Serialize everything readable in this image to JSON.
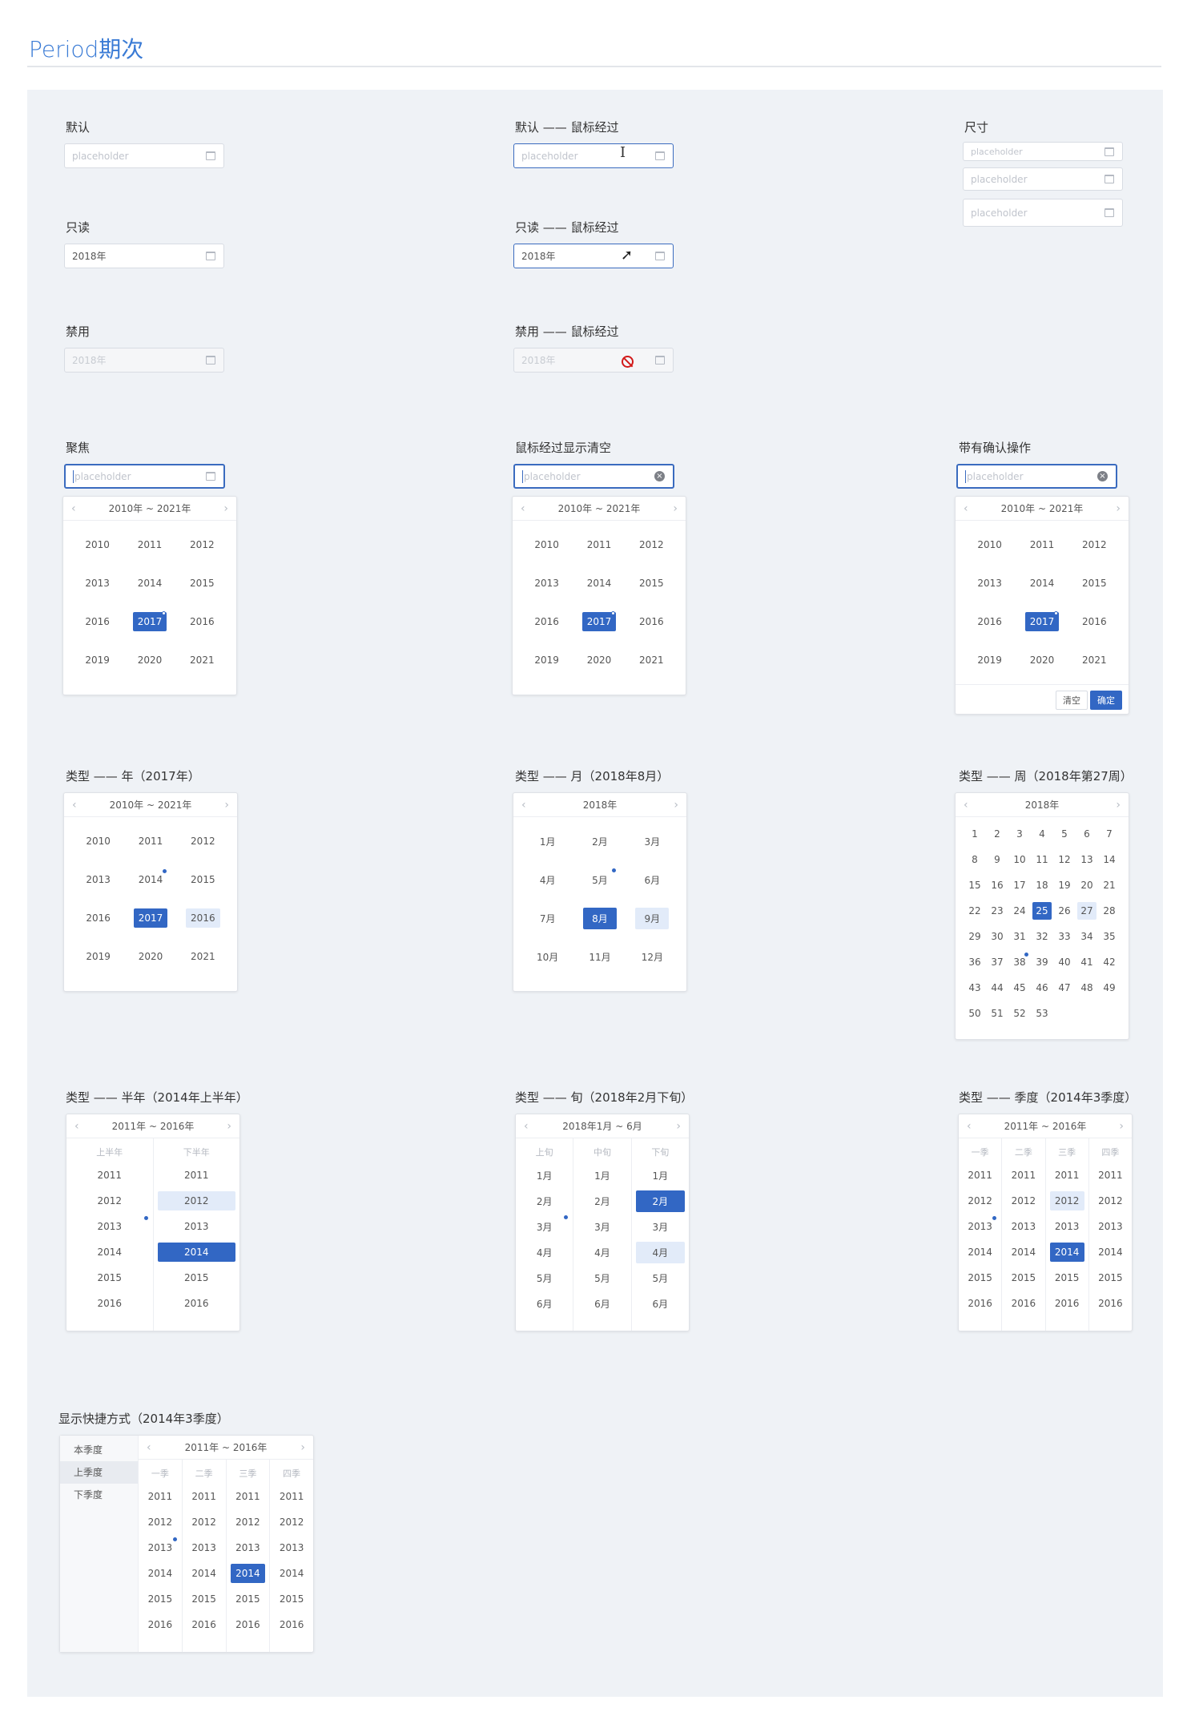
{
  "page_title": "Period期次",
  "labels": {
    "default": "默认",
    "default_hover": "默认 —— 鼠标经过",
    "size": "尺寸",
    "readonly": "只读",
    "readonly_hover": "只读 —— 鼠标经过",
    "disabled": "禁用",
    "disabled_hover": "禁用 —— 鼠标经过",
    "focus": "聚焦",
    "hover_clear": "鼠标经过显示清空",
    "confirm": "带有确认操作",
    "type_year": "类型 —— 年（2017年）",
    "type_month": "类型 —— 月（2018年8月）",
    "type_week": "类型 —— 周（2018年第27周）",
    "type_half": "类型 —— 半年（2014年上半年）",
    "type_ten": "类型 —— 旬（2018年2月下旬）",
    "type_quarter": "类型 —— 季度（2014年3季度）",
    "shortcut": "显示快捷方式（2014年3季度）"
  },
  "inputs": {
    "placeholder": "placeholder",
    "value": "2018年"
  },
  "year_header": "2010年 ~ 2021年",
  "years": [
    "2010",
    "2011",
    "2012",
    "2013",
    "2014",
    "2015",
    "2016",
    "2017",
    "2016",
    "2019",
    "2020",
    "2021"
  ],
  "type_years": [
    "2010",
    "2011",
    "2012",
    "2013",
    "2014",
    "2015",
    "2016",
    "2017",
    "2016",
    "2019",
    "2020",
    "2021"
  ],
  "month_header": "2018年",
  "months": [
    "1月",
    "2月",
    "3月",
    "4月",
    "5月",
    "6月",
    "7月",
    "8月",
    "9月",
    "10月",
    "11月",
    "12月"
  ],
  "week_header": "2018年",
  "weeks": [
    "1",
    "2",
    "3",
    "4",
    "5",
    "6",
    "7",
    "8",
    "9",
    "10",
    "11",
    "12",
    "13",
    "14",
    "15",
    "16",
    "17",
    "18",
    "19",
    "20",
    "21",
    "22",
    "23",
    "24",
    "25",
    "26",
    "27",
    "28",
    "29",
    "30",
    "31",
    "32",
    "33",
    "34",
    "35",
    "36",
    "37",
    "38",
    "39",
    "40",
    "41",
    "42",
    "43",
    "44",
    "45",
    "46",
    "47",
    "48",
    "49",
    "50",
    "51",
    "52",
    "53"
  ],
  "range_header": "2011年 ~ 2016年",
  "range_years": [
    "2011",
    "2012",
    "2013",
    "2014",
    "2015",
    "2016"
  ],
  "half": {
    "cols": [
      "上半年",
      "下半年"
    ]
  },
  "ten": {
    "header": "2018年1月 ~ 6月",
    "cols": [
      "上旬",
      "中旬",
      "下旬"
    ],
    "months": [
      "1月",
      "2月",
      "3月",
      "4月",
      "5月",
      "6月"
    ]
  },
  "quarter": {
    "cols": [
      "一季",
      "二季",
      "三季",
      "四季"
    ]
  },
  "buttons": {
    "clear": "清空",
    "ok": "确定"
  },
  "shortcuts": [
    "本季度",
    "上季度",
    "下季度"
  ],
  "icons": {
    "prev": "‹",
    "next": "›",
    "clear": "×",
    "calendar": "calendar-icon"
  },
  "colors": {
    "accent": "#3267c4",
    "range": "#e2ebf9",
    "title": "#3a7bd5",
    "board": "#eff2f6"
  }
}
